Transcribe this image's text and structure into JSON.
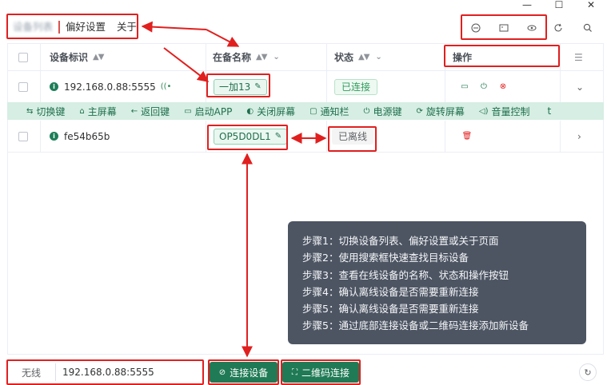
{
  "window": {
    "minimize": "—",
    "maximize": "☐",
    "close": "✕"
  },
  "tabs": {
    "device_list": "设备列表",
    "preferences": "偏好设置",
    "about": "关于"
  },
  "table": {
    "headers": {
      "device_id": "设备标识",
      "name": "在备名称",
      "status": "状态",
      "actions": "操作"
    },
    "rows": [
      {
        "device_id": "192.168.0.88:5555",
        "name": "一加13",
        "status": "已连接"
      },
      {
        "device_id": "fe54b65b",
        "name": "OP5D0DL1",
        "status": "已离线"
      }
    ]
  },
  "toolbar": [
    {
      "icon": "switch-icon",
      "label": "切换键"
    },
    {
      "icon": "home-icon",
      "label": "主屏幕"
    },
    {
      "icon": "back-icon",
      "label": "返回键"
    },
    {
      "icon": "app-icon",
      "label": "启动APP"
    },
    {
      "icon": "screen-off-icon",
      "label": "关闭屏幕"
    },
    {
      "icon": "notification-icon",
      "label": "通知栏"
    },
    {
      "icon": "power-icon",
      "label": "电源键"
    },
    {
      "icon": "rotate-icon",
      "label": "旋转屏幕"
    },
    {
      "icon": "volume-icon",
      "label": "音量控制"
    },
    {
      "icon": "more-icon",
      "label": "t"
    }
  ],
  "steps": [
    "步骤1：切换设备列表、偏好设置或关于页面",
    "步骤2：使用搜索框快速查找目标设备",
    "步骤3：查看在线设备的名称、状态和操作按钮",
    "步骤4：确认离线设备是否需要重新连接",
    "步骤5：确认离线设备是否需要重新连接",
    "步骤5：通过底部连接设备或二维码连接添加新设备"
  ],
  "bottom": {
    "mode": "无线",
    "address": "192.168.0.88:5555",
    "connect_label": "连接设备",
    "qr_label": "二维码连接"
  },
  "colors": {
    "annotation": "#e0201f",
    "primary": "#1f7a55",
    "tooltip_bg": "#4d5563"
  }
}
